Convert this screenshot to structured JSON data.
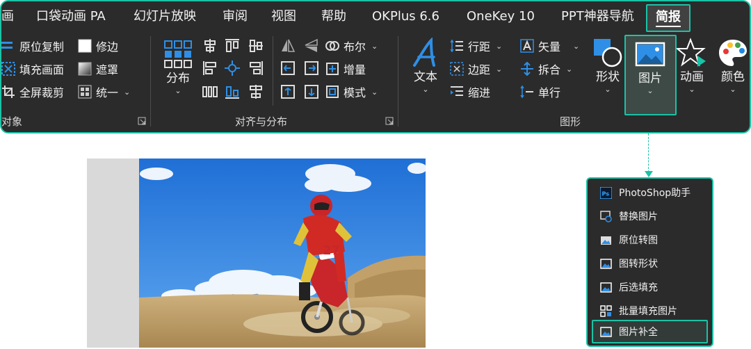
{
  "tabs": [
    {
      "label": "画"
    },
    {
      "label": "口袋动画 PA"
    },
    {
      "label": "幻灯片放映"
    },
    {
      "label": "审阅"
    },
    {
      "label": "视图"
    },
    {
      "label": "帮助"
    },
    {
      "label": "OKPlus 6.6"
    },
    {
      "label": "OneKey 10"
    },
    {
      "label": "PPT神器导航"
    },
    {
      "label": "简报",
      "active": true
    }
  ],
  "groups": {
    "object": {
      "label": "对象",
      "buttons": {
        "copy_in_place": "原位复制",
        "trim_edges": "修边",
        "fill_slide": "填充画面",
        "mask": "遮罩",
        "fullscreen_crop": "全屏裁剪",
        "unify": "统一"
      }
    },
    "align": {
      "label": "对齐与分布",
      "distribute": "分布",
      "buttons": {
        "boolean": "布尔",
        "increment": "增量",
        "mode": "模式"
      }
    },
    "shape": {
      "label": "图形",
      "text": "文本",
      "buttons": {
        "line_spacing": "行距",
        "vector": "矢量",
        "margin": "边距",
        "split_merge": "拆合",
        "indent": "缩进",
        "single_line": "单行"
      },
      "shape_btn": "形状",
      "picture_btn": "图片",
      "animation_btn": "动画",
      "color_btn": "颜色"
    }
  },
  "dropdown": {
    "items": [
      {
        "label": "PhotoShop助手",
        "icon": "photoshop-icon"
      },
      {
        "label": "替换图片",
        "icon": "replace-picture-icon"
      },
      {
        "label": "原位转图",
        "icon": "convert-to-picture-icon"
      },
      {
        "label": "图转形状",
        "icon": "picture-to-shape-icon"
      },
      {
        "label": "后选填充",
        "icon": "fill-icon"
      },
      {
        "label": "批量填充图片",
        "icon": "batch-fill-icon"
      },
      {
        "label": "图片补全",
        "icon": "picture-complete-icon",
        "highlighted": true
      }
    ]
  },
  "image": {
    "bib_number": "27"
  },
  "colors": {
    "accent": "#19c3a7",
    "ribbon_bg": "#2b2b2b",
    "icon_blue": "#2f8fe6"
  }
}
